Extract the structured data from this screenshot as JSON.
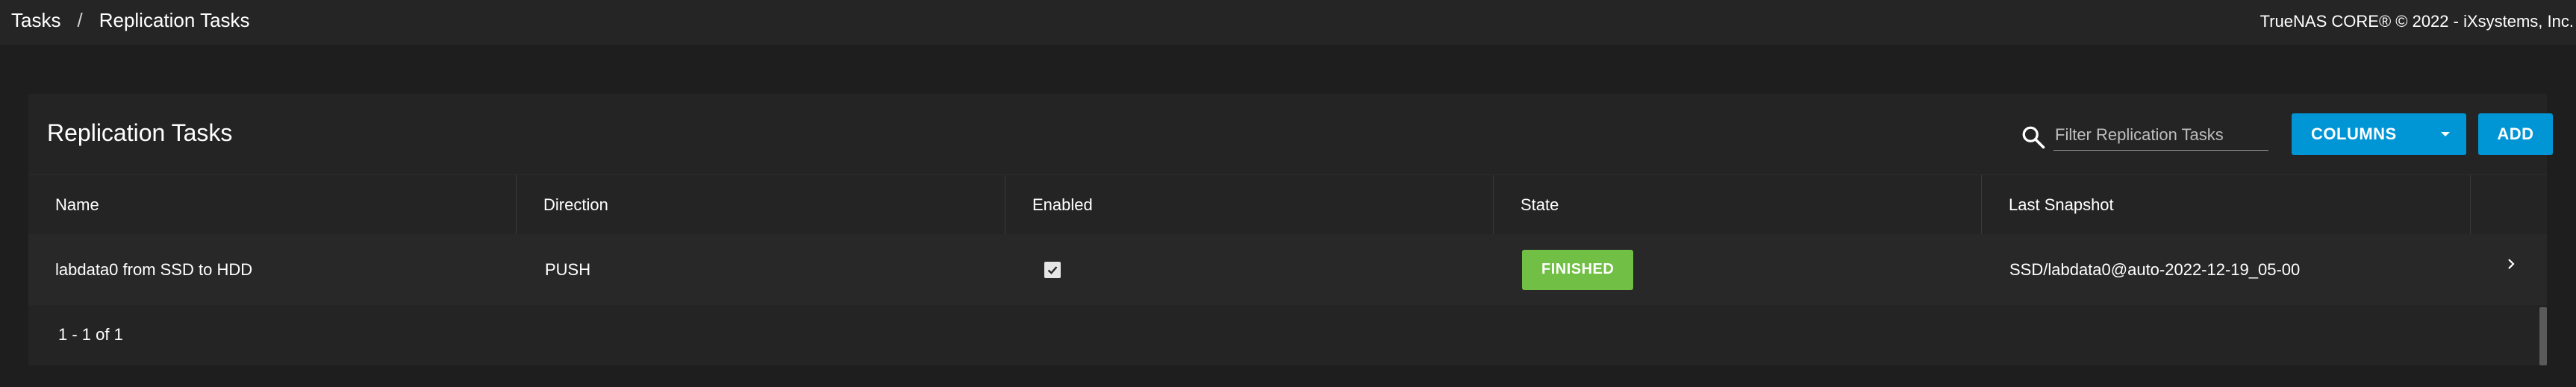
{
  "breadcrumb": {
    "root": "Tasks",
    "separator": "/",
    "current": "Replication Tasks"
  },
  "copyright": "TrueNAS CORE® © 2022 - iXsystems, Inc.",
  "card": {
    "title": "Replication Tasks",
    "search_placeholder": "Filter Replication Tasks",
    "columns_label": "COLUMNS",
    "add_label": "ADD"
  },
  "table": {
    "columns": [
      "Name",
      "Direction",
      "Enabled",
      "State",
      "Last Snapshot"
    ],
    "rows": [
      {
        "name": "labdata0 from SSD to HDD",
        "direction": "PUSH",
        "enabled": true,
        "state": "FINISHED",
        "last_snapshot": "SSD/labdata0@auto-2022-12-19_05-00"
      }
    ],
    "pagination": "1 - 1 of 1"
  },
  "colors": {
    "accent": "#0095d5",
    "success": "#71bf44",
    "background": "#1e1e1e",
    "card": "#242424"
  },
  "icons": {
    "search": "search-icon",
    "caret": "caret-down-icon",
    "expand": "chevron-right-icon",
    "check": "check-icon"
  }
}
